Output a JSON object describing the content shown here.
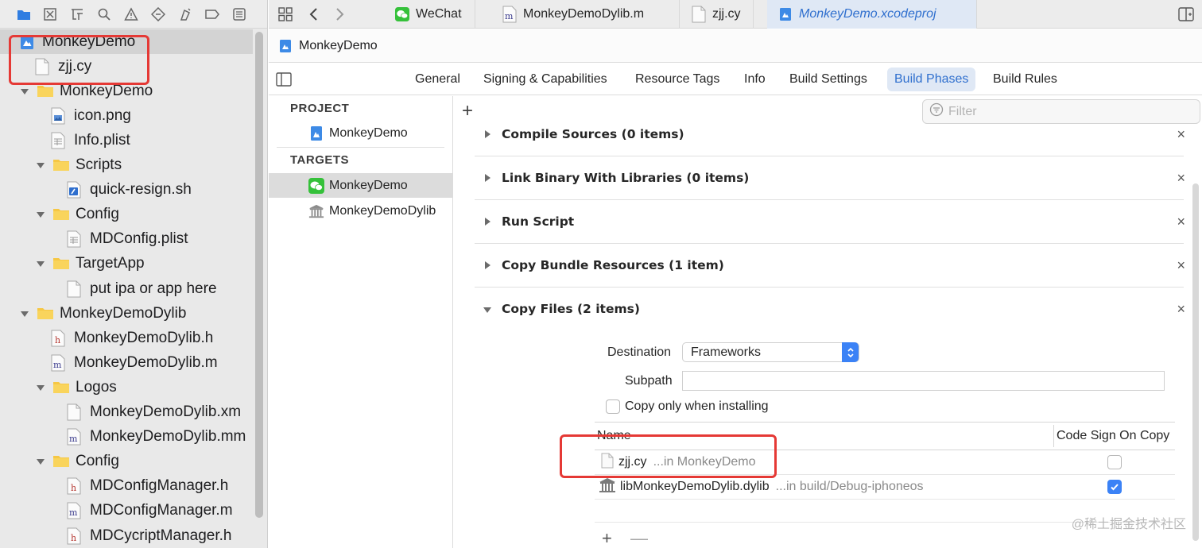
{
  "navigator": {
    "tree": [
      {
        "label": "MonkeyDemo",
        "icon": "project-icon",
        "depth": 0,
        "disclosure": "none"
      },
      {
        "label": "zjj.cy",
        "icon": "file-icon",
        "depth": 1,
        "disclosure": "none"
      },
      {
        "label": "MonkeyDemo",
        "icon": "folder-icon",
        "depth": 1,
        "disclosure": "open"
      },
      {
        "label": "icon.png",
        "icon": "image-file-icon",
        "depth": 2,
        "disclosure": "none"
      },
      {
        "label": "Info.plist",
        "icon": "plist-file-icon",
        "depth": 2,
        "disclosure": "none"
      },
      {
        "label": "Scripts",
        "icon": "folder-icon",
        "depth": 2,
        "disclosure": "open"
      },
      {
        "label": "quick-resign.sh",
        "icon": "shell-script-icon",
        "depth": 3,
        "disclosure": "none"
      },
      {
        "label": "Config",
        "icon": "folder-icon",
        "depth": 2,
        "disclosure": "open"
      },
      {
        "label": "MDConfig.plist",
        "icon": "plist-file-icon",
        "depth": 3,
        "disclosure": "none"
      },
      {
        "label": "TargetApp",
        "icon": "folder-icon",
        "depth": 2,
        "disclosure": "open"
      },
      {
        "label": "put ipa or app here",
        "icon": "file-icon",
        "depth": 3,
        "disclosure": "none"
      },
      {
        "label": "MonkeyDemoDylib",
        "icon": "folder-icon",
        "depth": 1,
        "disclosure": "open"
      },
      {
        "label": "MonkeyDemoDylib.h",
        "icon": "header-file-icon",
        "depth": 2,
        "disclosure": "none"
      },
      {
        "label": "MonkeyDemoDylib.m",
        "icon": "objc-file-icon",
        "depth": 2,
        "disclosure": "none"
      },
      {
        "label": "Logos",
        "icon": "folder-icon",
        "depth": 2,
        "disclosure": "open"
      },
      {
        "label": "MonkeyDemoDylib.xm",
        "icon": "file-icon",
        "depth": 3,
        "disclosure": "none"
      },
      {
        "label": "MonkeyDemoDylib.mm",
        "icon": "objc-file-icon",
        "depth": 3,
        "disclosure": "none"
      },
      {
        "label": "Config",
        "icon": "folder-icon",
        "depth": 2,
        "disclosure": "open"
      },
      {
        "label": "MDConfigManager.h",
        "icon": "header-file-icon",
        "depth": 3,
        "disclosure": "none"
      },
      {
        "label": "MDConfigManager.m",
        "icon": "objc-file-icon",
        "depth": 3,
        "disclosure": "none"
      },
      {
        "label": "MDCycriptManager.h",
        "icon": "header-file-icon",
        "depth": 3,
        "disclosure": "none"
      }
    ]
  },
  "toolbar": {
    "tabs": [
      {
        "label": "WeChat",
        "icon": "wechat-icon"
      },
      {
        "label": "MonkeyDemoDylib.m",
        "icon": "objc-file-icon"
      },
      {
        "label": "zjj.cy",
        "icon": "file-icon"
      },
      {
        "label": "MonkeyDemo.xcodeproj",
        "icon": "project-icon"
      }
    ]
  },
  "jump_bar": {
    "label": "MonkeyDemo"
  },
  "settings_tabs": [
    "General",
    "Signing & Capabilities",
    "Resource Tags",
    "Info",
    "Build Settings",
    "Build Phases",
    "Build Rules"
  ],
  "active_settings_tab": "Build Phases",
  "project_list": {
    "project_header": "PROJECT",
    "project_item": "MonkeyDemo",
    "targets_header": "TARGETS",
    "targets": [
      "MonkeyDemo",
      "MonkeyDemoDylib"
    ]
  },
  "phases": {
    "add_label": "+",
    "filter_placeholder": "Filter",
    "list": [
      {
        "title": "Compile Sources (0 items)",
        "expanded": false
      },
      {
        "title": "Link Binary With Libraries (0 items)",
        "expanded": false
      },
      {
        "title": "Run Script",
        "expanded": false
      },
      {
        "title": "Copy Bundle Resources (1 item)",
        "expanded": false
      },
      {
        "title": "Copy Files (2 items)",
        "expanded": true
      }
    ],
    "close_label": "×"
  },
  "copy_files": {
    "destination_label": "Destination",
    "destination_value": "Frameworks",
    "subpath_label": "Subpath",
    "subpath_value": "",
    "copy_only_label": "Copy only when installing",
    "copy_only_checked": false,
    "table": {
      "name_header": "Name",
      "code_sign_header": "Code Sign On Copy",
      "rows": [
        {
          "name": "zjj.cy",
          "location": "...in MonkeyDemo",
          "icon": "file-icon",
          "code_sign": false
        },
        {
          "name": "libMonkeyDemoDylib.dylib",
          "location": "...in build/Debug-iphoneos",
          "icon": "library-icon",
          "code_sign": true
        }
      ]
    },
    "add_label": "+",
    "remove_label": "—"
  },
  "watermark": "@稀土掘金技术社区",
  "colors": {
    "accent": "#3b82f6",
    "annotation": "#e53935"
  }
}
